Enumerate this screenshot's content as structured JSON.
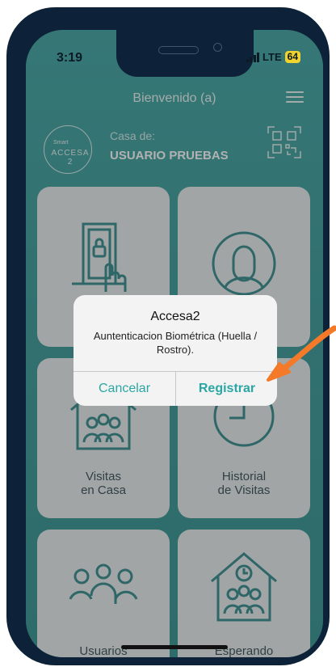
{
  "status": {
    "time": "3:19",
    "network": "LTE",
    "battery": "64"
  },
  "header": {
    "title": "Bienvenido (a)"
  },
  "house": {
    "logo_small": "Smart",
    "logo_big": "ACCESA 2",
    "label": "Casa de:",
    "user": "USUARIO PRUEBAS"
  },
  "cards": [
    {
      "label": ""
    },
    {
      "label": ""
    },
    {
      "label": "Visitas\nen Casa"
    },
    {
      "label": "Historial\nde Visitas"
    },
    {
      "label": "Usuarios\nAutorizados"
    },
    {
      "label": "Esperando\nAutorización"
    }
  ],
  "dialog": {
    "title": "Accesa2",
    "message": "Auntenticacion Biométrica (Huella / Rostro).",
    "cancel_label": "Cancelar",
    "confirm_label": "Registrar"
  },
  "colors": {
    "accent": "#2aa7a4",
    "arrow": "#f47a2a",
    "frame": "#0d2238"
  },
  "icons": [
    "menu-icon",
    "qr-code-icon",
    "door-access-icon",
    "user-face-icon",
    "house-visitors-icon",
    "clock-history-icon",
    "users-group-icon",
    "house-waiting-icon",
    "arrow-icon"
  ]
}
